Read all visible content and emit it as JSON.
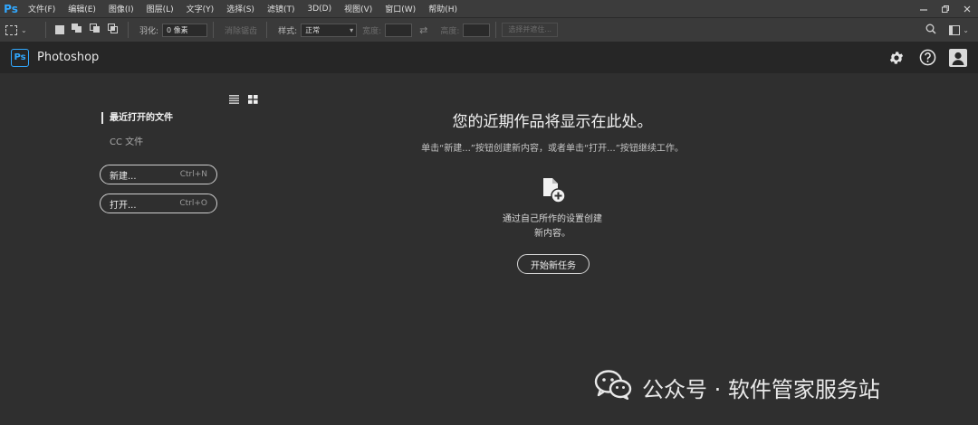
{
  "menubar": {
    "logo": "Ps",
    "items": [
      "文件(F)",
      "编辑(E)",
      "图像(I)",
      "图层(L)",
      "文字(Y)",
      "选择(S)",
      "滤镜(T)",
      "3D(D)",
      "视图(V)",
      "窗口(W)",
      "帮助(H)"
    ],
    "window_controls": [
      "minimize-icon",
      "restore-icon",
      "close-icon"
    ]
  },
  "optbar": {
    "feather_label": "羽化:",
    "feather_value": "0 像素",
    "antialias_label": "消除锯齿",
    "style_label": "样式:",
    "style_value": "正常",
    "width_label": "宽度:",
    "height_label": "高度:",
    "select_mask_label": "选择并遮住..."
  },
  "header": {
    "logo": "Ps",
    "app_name": "Photoshop",
    "icons": [
      "gear-icon",
      "help-icon",
      "user-avatar-icon"
    ]
  },
  "sidebar": {
    "recent_label": "最近打开的文件",
    "cc_label": "CC 文件",
    "new_button": {
      "label": "新建...",
      "shortcut": "Ctrl+N"
    },
    "open_button": {
      "label": "打开...",
      "shortcut": "Ctrl+O"
    }
  },
  "main": {
    "title": "您的近期作品将显示在此处。",
    "subtitle": "单击“新建...”按钮创建新内容，或者单击“打开...”按钮继续工作。",
    "hint_line1": "通过自己所作的设置创建",
    "hint_line2": "新内容。",
    "start_button": "开始新任务"
  },
  "watermark": {
    "text": "公众号 · 软件管家服务站"
  },
  "colors": {
    "accent": "#31a8ff",
    "background": "#2f2f2f",
    "header": "#262626"
  }
}
